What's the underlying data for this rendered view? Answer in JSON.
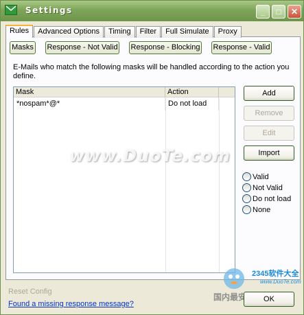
{
  "window": {
    "title": "Settings"
  },
  "title_buttons": {
    "min": "_",
    "max": "□",
    "close": "✕"
  },
  "tabs": [
    "Rules",
    "Advanced Options",
    "Timing",
    "Filter",
    "Full Simulate",
    "Proxy"
  ],
  "mask_buttons": [
    "Masks",
    "Response - Not Valid",
    "Response - Blocking",
    "Response - Valid"
  ],
  "description": "E-Mails who match the following masks will be handled according to the action you define.",
  "table": {
    "columns": [
      "Mask",
      "Action"
    ],
    "rows": [
      {
        "mask": "*nospam*@*",
        "action": "Do not load"
      }
    ]
  },
  "side_buttons": {
    "add": "Add",
    "remove": "Remove",
    "edit": "Edit",
    "import": "Import"
  },
  "radios": [
    "Valid",
    "Not Valid",
    "Do not load",
    "None"
  ],
  "footer": {
    "reset": "Reset Config",
    "link": "Found a missing response message?",
    "ok": "OK"
  },
  "watermark": {
    "text": "www.DuoTe.com",
    "brand": "2345软件大全",
    "url": "www.DuoTe.com",
    "cn": "国内最安全的软件站"
  }
}
